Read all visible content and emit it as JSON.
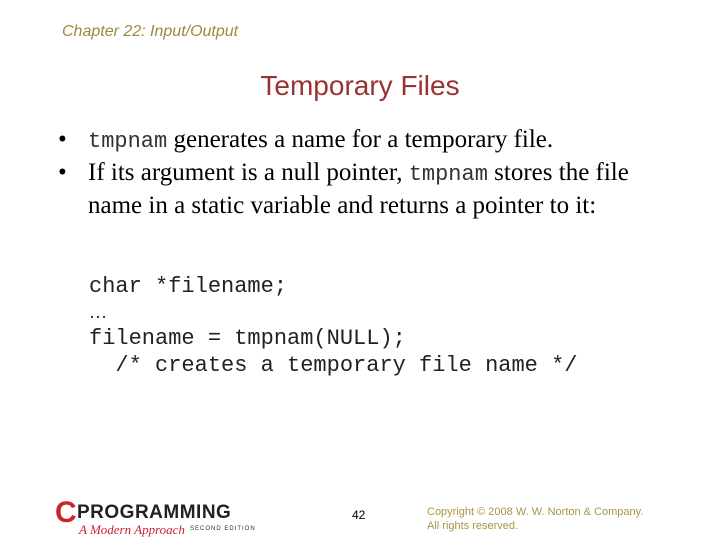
{
  "header": {
    "chapter": "Chapter 22: Input/Output"
  },
  "slide": {
    "title": "Temporary Files",
    "bullets": [
      {
        "code": "tmpnam",
        "text_after": " generates a name for a temporary file."
      },
      {
        "text_before": "If its argument is a null pointer, ",
        "code": "tmpnam",
        "text_after": " stores the file name in a static variable and returns a pointer to it:"
      }
    ],
    "bullet_glyph": "•",
    "code_lines": [
      "char *filename;",
      "…",
      "filename = tmpnam(NULL);",
      "  /* creates a temporary file name */"
    ]
  },
  "footer": {
    "logo": {
      "c": "C",
      "main": "PROGRAMMING",
      "sub": "A Modern Approach",
      "edition": "SECOND EDITION",
      "accent": "#c8262c"
    },
    "page_number": "42",
    "copyright_line1": "Copyright © 2008 W. W. Norton & Company.",
    "copyright_line2": "All rights reserved."
  }
}
